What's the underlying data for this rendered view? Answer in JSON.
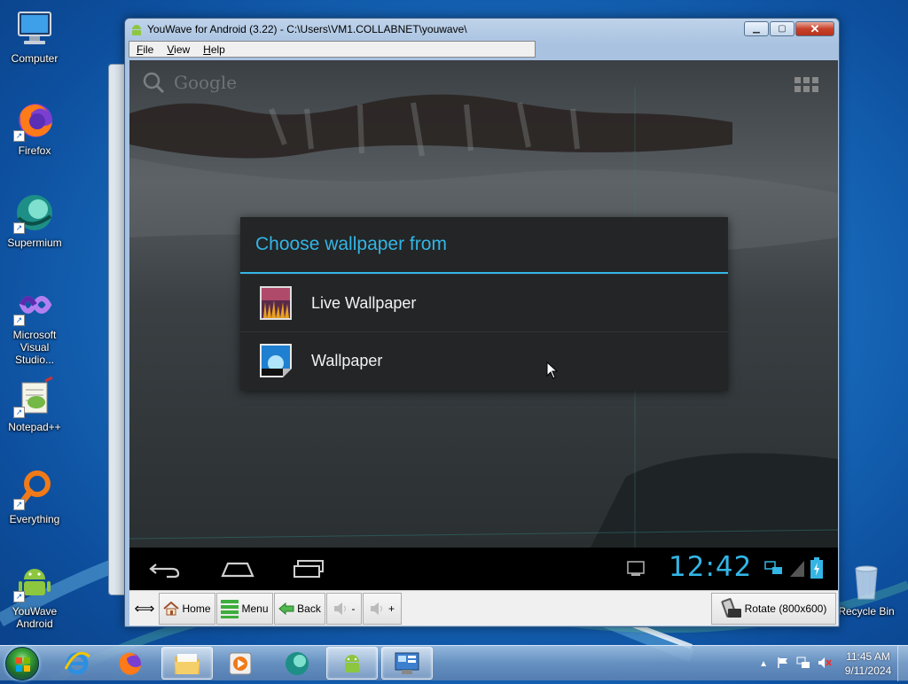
{
  "desktop": {
    "icons": [
      {
        "label": "Computer",
        "icon": "computer-icon"
      },
      {
        "label": "Firefox",
        "icon": "firefox-icon"
      },
      {
        "label": "Supermium",
        "icon": "supermium-icon"
      },
      {
        "label": "Microsoft Visual Studio...",
        "icon": "visual-studio-icon"
      },
      {
        "label": "Notepad++",
        "icon": "notepadpp-icon"
      },
      {
        "label": "Everything",
        "icon": "everything-icon"
      },
      {
        "label": "YouWave Android",
        "icon": "android-icon"
      }
    ],
    "recycle_bin": {
      "label": "Recycle Bin",
      "icon": "recycle-bin-icon"
    }
  },
  "window": {
    "title": "YouWave for Android (3.22) - C:\\Users\\VM1.COLLABNET\\youwave\\",
    "menu": [
      {
        "label": "File",
        "mnemonic": "F"
      },
      {
        "label": "View",
        "mnemonic": "V"
      },
      {
        "label": "Help",
        "mnemonic": "H"
      }
    ]
  },
  "android": {
    "search_hint": "Google",
    "dialog": {
      "title": "Choose wallpaper from",
      "items": [
        {
          "label": "Live Wallpaper",
          "icon": "live-wallpaper-icon"
        },
        {
          "label": "Wallpaper",
          "icon": "wallpaper-icon"
        }
      ]
    },
    "status": {
      "time": "12:42"
    }
  },
  "toolbar": {
    "home": "Home",
    "menu": "Menu",
    "back": "Back",
    "vol_down": "-",
    "vol_up": "+",
    "rotate": "Rotate (800x600)"
  },
  "taskbar": {
    "time": "11:45 AM",
    "date": "9/11/2024"
  },
  "colors": {
    "accent": "#33b5e5",
    "dialog_bg": "#232526"
  }
}
